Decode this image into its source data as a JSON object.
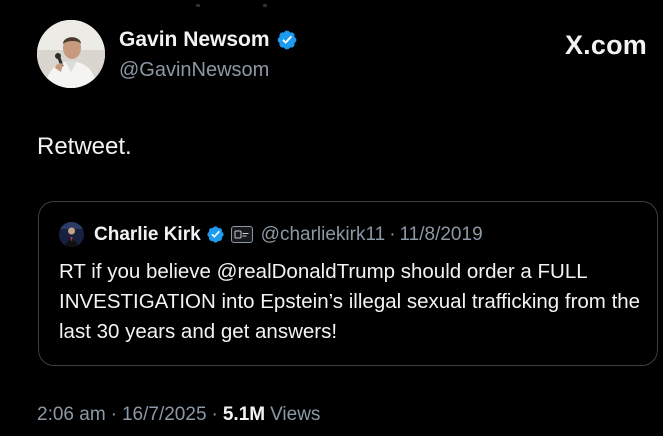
{
  "brand": {
    "logo_text": "X.com",
    "icon": "x-logo-icon"
  },
  "author": {
    "name": "Gavin Newsom",
    "handle": "@GavinNewsom",
    "verified": true,
    "verified_icon": "verified-badge-icon",
    "avatar_icon": "avatar-photo"
  },
  "tweet": {
    "text": "Retweet.",
    "time": "2:06 am",
    "date": "16/7/2025",
    "separator": "·",
    "views_count": "5.1M",
    "views_label": "Views"
  },
  "quote": {
    "name": "Charlie Kirk",
    "handle": "@charliekirk11",
    "separator": "·",
    "date": "11/8/2019",
    "verified": true,
    "verified_icon": "verified-badge-icon",
    "affiliate_icon": "affiliate-badge-icon",
    "text": "RT if you believe @realDonaldTrump should order a FULL INVESTIGATION into Epstein’s illegal sexual trafficking from the last 30 years and get answers!"
  },
  "colors": {
    "background": "#000000",
    "primary_text": "#f2f3f4",
    "secondary_text": "#8b98a5",
    "verified_blue": "#1d9bf0",
    "border": "#3a3f44"
  }
}
